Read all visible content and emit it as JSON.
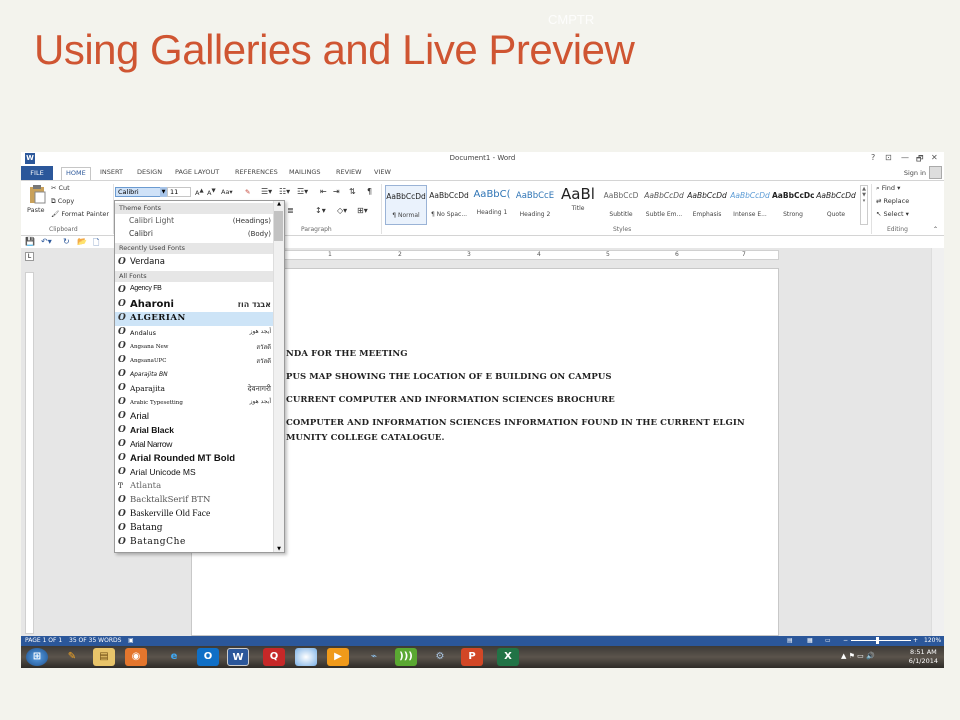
{
  "slide": {
    "title": "Using Galleries and Live Preview",
    "tag": "CMPTR"
  },
  "window": {
    "title": "Document1 - Word",
    "controls": [
      "?",
      "⊡",
      "—",
      "🗗",
      "✕"
    ]
  },
  "tabs": [
    "FILE",
    "HOME",
    "INSERT",
    "DESIGN",
    "PAGE LAYOUT",
    "REFERENCES",
    "MAILINGS",
    "REVIEW",
    "VIEW"
  ],
  "signin": "Sign in",
  "clipboard": {
    "paste": "Paste",
    "cut": "Cut",
    "copy": "Copy",
    "format_painter": "Format Painter",
    "label": "Clipboard"
  },
  "font": {
    "name": "Calibri",
    "size": "11"
  },
  "paragraph_label": "Paragraph",
  "styles": {
    "label": "Styles",
    "items": [
      {
        "preview": "AaBbCcDd",
        "name": "¶ Normal"
      },
      {
        "preview": "AaBbCcDd",
        "name": "¶ No Spac..."
      },
      {
        "preview": "AaBbC(",
        "name": "Heading 1"
      },
      {
        "preview": "AaBbCcE",
        "name": "Heading 2"
      },
      {
        "preview": "AaBl",
        "name": "Title"
      },
      {
        "preview": "AaBbCcD",
        "name": "Subtitle"
      },
      {
        "preview": "AaBbCcDd",
        "name": "Subtle Em..."
      },
      {
        "preview": "AaBbCcDd",
        "name": "Emphasis"
      },
      {
        "preview": "AaBbCcDd",
        "name": "Intense E..."
      },
      {
        "preview": "AaBbCcDc",
        "name": "Strong"
      },
      {
        "preview": "AaBbCcDd",
        "name": "Quote"
      }
    ]
  },
  "editing": {
    "find": "Find",
    "replace": "Replace",
    "select": "Select",
    "label": "Editing"
  },
  "ruler_numbers": [
    "1",
    "2",
    "3",
    "4",
    "5",
    "6",
    "7"
  ],
  "font_dropdown": {
    "theme_header": "Theme Fonts",
    "theme_fonts": [
      {
        "name": "Calibri Light",
        "tag": "(Headings)"
      },
      {
        "name": "Calibri",
        "tag": "(Body)"
      }
    ],
    "recent_header": "Recently Used Fonts",
    "recent": [
      "Verdana"
    ],
    "all_header": "All Fonts",
    "fonts": [
      {
        "name": "Agency FB",
        "sample": ""
      },
      {
        "name": "Aharoni",
        "sample": "אבגד הוז"
      },
      {
        "name": "ALGERIAN",
        "sample": ""
      },
      {
        "name": "Andalus",
        "sample": "أيجد هوز"
      },
      {
        "name": "Angsana New",
        "sample": "สวัสดี"
      },
      {
        "name": "AngsanaUPC",
        "sample": "สวัสดี"
      },
      {
        "name": "Aparajita BN",
        "sample": ""
      },
      {
        "name": "Aparajita",
        "sample": "देवनागरी"
      },
      {
        "name": "Arabic Typesetting",
        "sample": "أيجد هوز"
      },
      {
        "name": "Arial",
        "sample": ""
      },
      {
        "name": "Arial Black",
        "sample": ""
      },
      {
        "name": "Arial Narrow",
        "sample": ""
      },
      {
        "name": "Arial Rounded MT Bold",
        "sample": ""
      },
      {
        "name": "Arial Unicode MS",
        "sample": ""
      },
      {
        "name": "Atlanta",
        "sample": ""
      },
      {
        "name": "BacktalkSerif BTN",
        "sample": ""
      },
      {
        "name": "Baskerville Old Face",
        "sample": ""
      },
      {
        "name": "Batang",
        "sample": ""
      },
      {
        "name": "BatangChe",
        "sample": ""
      }
    ]
  },
  "document_lines": [
    "NDA FOR THE MEETING",
    "PUS MAP SHOWING THE LOCATION OF E BUILDING ON CAMPUS",
    "CURRENT COMPUTER AND INFORMATION SCIENCES BROCHURE",
    "COMPUTER AND INFORMATION SCIENCES INFORMATION FOUND IN THE CURRENT ELGIN",
    "MUNITY COLLEGE CATALOGUE."
  ],
  "status": {
    "page": "PAGE 1 OF 1",
    "words": "35 OF 35 WORDS",
    "zoom": "120%"
  },
  "taskbar": {
    "time": "8:51 AM",
    "date": "6/1/2014"
  },
  "colors": {
    "accent": "#2b579a",
    "title": "#cf5532"
  }
}
